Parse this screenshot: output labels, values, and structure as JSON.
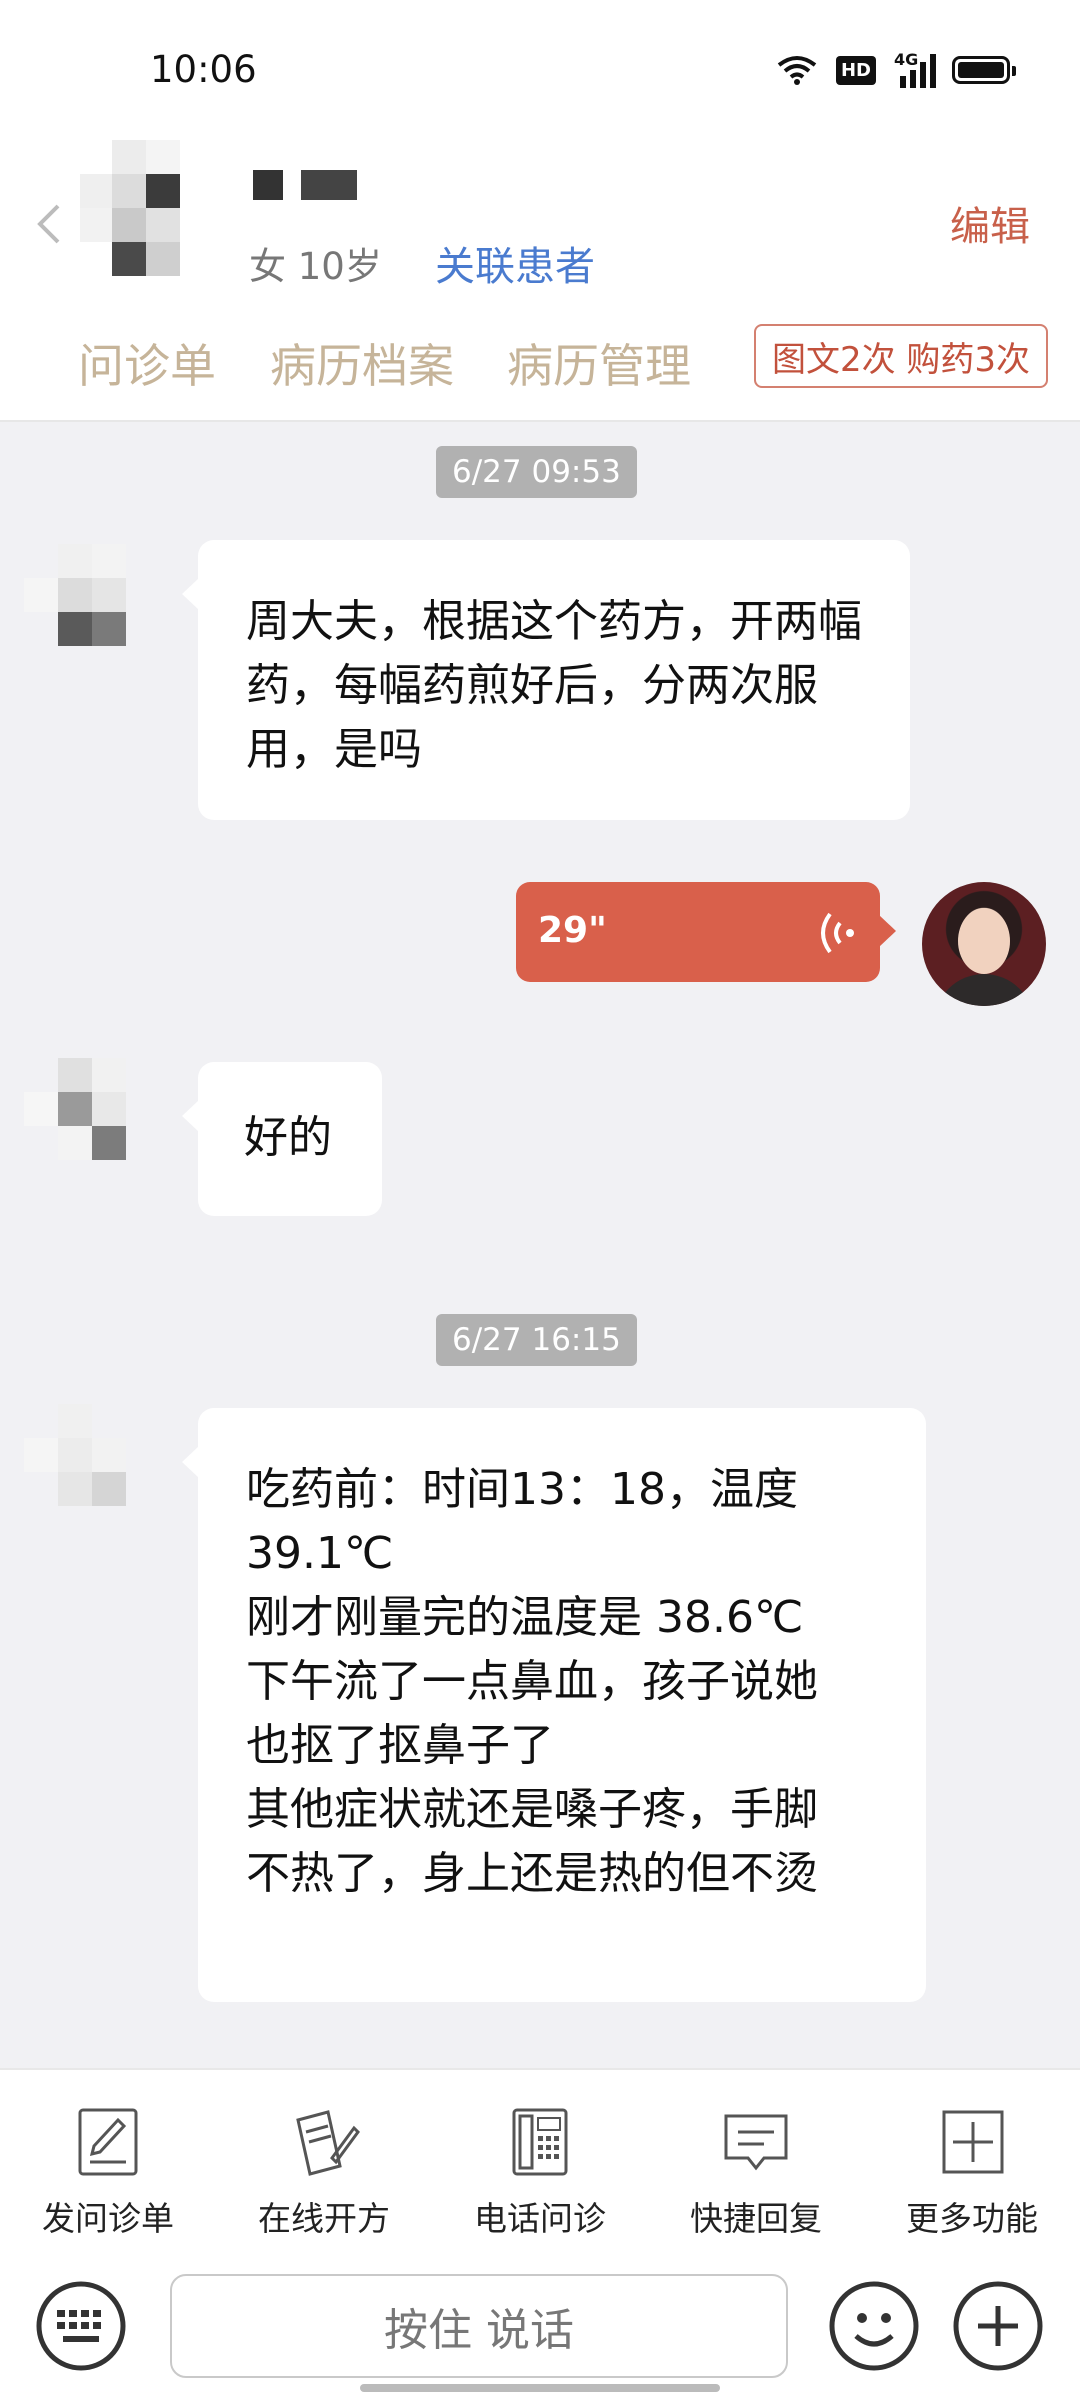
{
  "status_bar": {
    "time": "10:06",
    "hd_label": "HD",
    "network_label": "4G"
  },
  "header": {
    "back_icon": "chevron-left-icon",
    "sex_age": "女 10岁",
    "link_patient": "关联患者",
    "edit": "编辑",
    "tabs": [
      "问诊单",
      "病历档案",
      "病历管理"
    ],
    "quota": "图文2次 购药3次"
  },
  "messages": [
    {
      "type": "timestamp",
      "text": "6/27 09:53"
    },
    {
      "type": "patient",
      "text": "周大夫，根据这个药方，开两幅药，每幅药煎好后，分两次服用，是吗"
    },
    {
      "type": "doctor_voice",
      "duration": "29\"",
      "icon": "voice-wave-icon"
    },
    {
      "type": "patient",
      "text": "好的"
    },
    {
      "type": "timestamp",
      "text": "6/27 16:15"
    },
    {
      "type": "patient",
      "lines": [
        "吃药前：时间13：18，温度",
        "39.1℃",
        "刚才刚量完的温度是 38.6℃",
        "下午流了一点鼻血，孩子说她",
        "也抠了抠鼻子了",
        "其他症状就还是嗓子疼，手脚",
        "不热了，身上还是热的但不烫"
      ]
    }
  ],
  "toolbar": [
    {
      "label": "发问诊单",
      "icon": "form-edit-icon"
    },
    {
      "label": "在线开方",
      "icon": "prescription-icon"
    },
    {
      "label": "电话问诊",
      "icon": "phone-icon"
    },
    {
      "label": "快捷回复",
      "icon": "chat-bubble-icon"
    },
    {
      "label": "更多功能",
      "icon": "plus-square-icon"
    }
  ],
  "input_bar": {
    "hold_to_talk": "按住 说话"
  },
  "colors": {
    "accent_red": "#d9604b",
    "link_blue": "#4a7bcf",
    "tab_tan": "#c6b499",
    "bg": "#f1f1f4"
  }
}
